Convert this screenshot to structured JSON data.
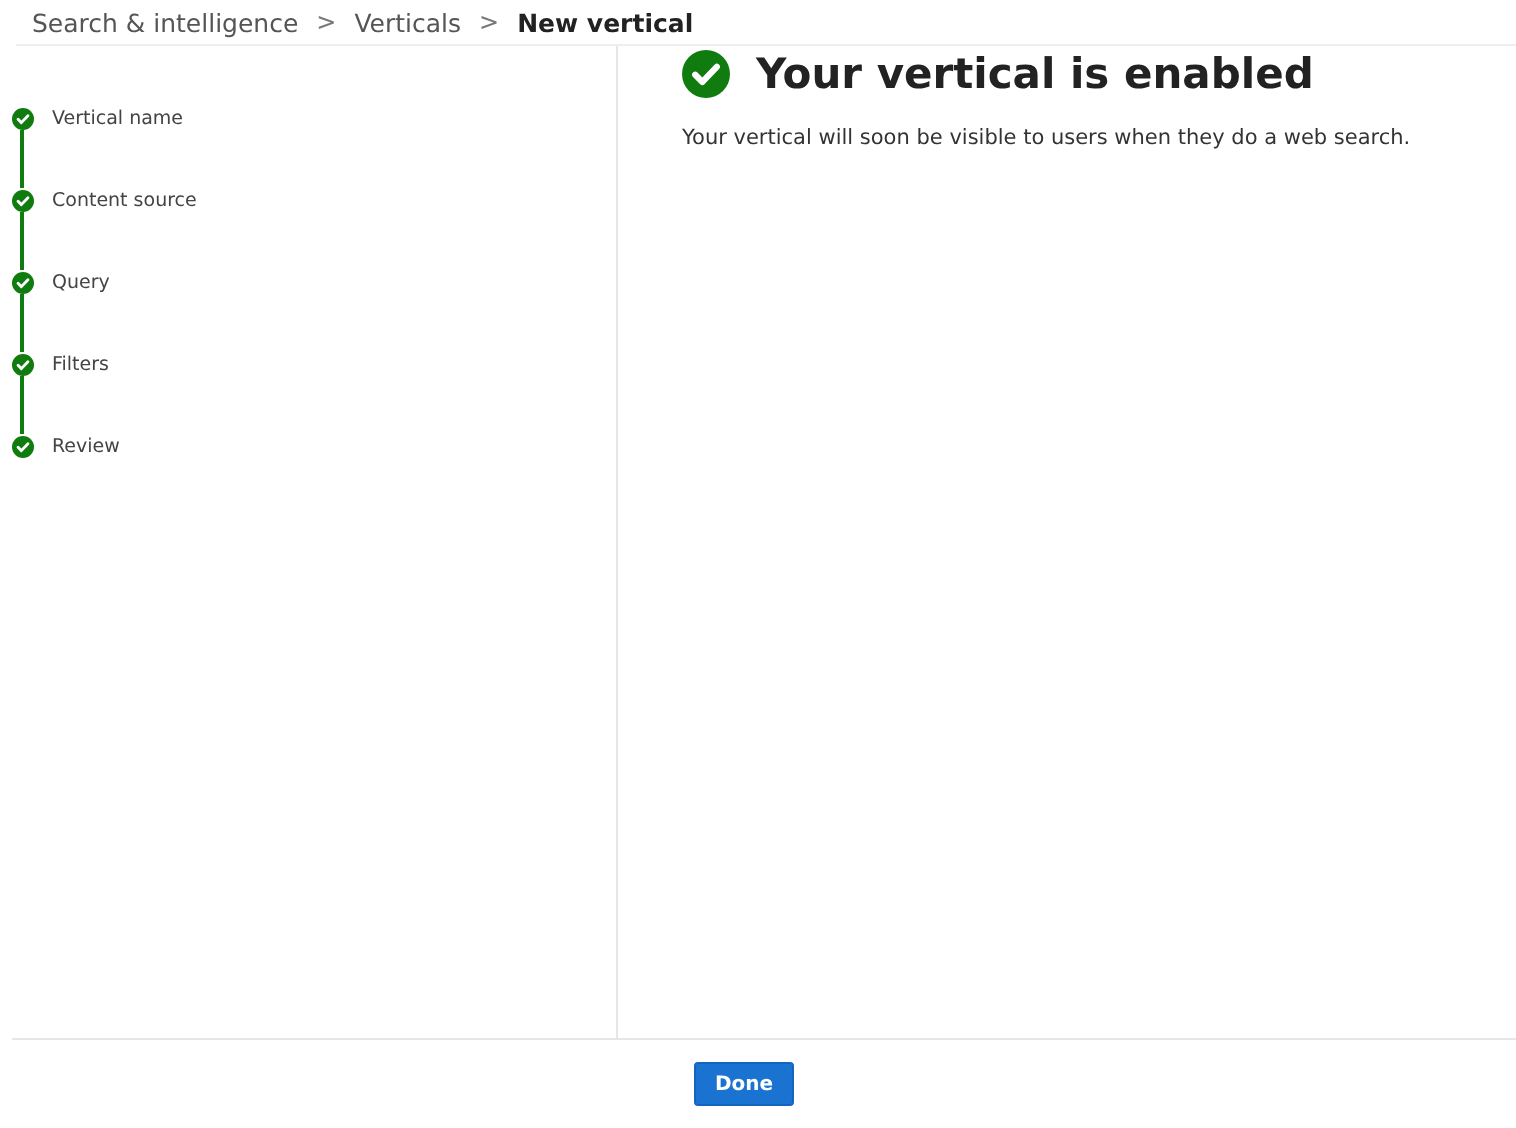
{
  "breadcrumb": [
    {
      "label": "Search & intelligence",
      "current": false
    },
    {
      "label": "Verticals",
      "current": false
    },
    {
      "label": "New vertical",
      "current": true
    }
  ],
  "breadcrumb_separator": ">",
  "steps": [
    {
      "label": "Vertical name",
      "completed": true
    },
    {
      "label": "Content source",
      "completed": true
    },
    {
      "label": "Query",
      "completed": true
    },
    {
      "label": "Filters",
      "completed": true
    },
    {
      "label": "Review",
      "completed": true
    }
  ],
  "result": {
    "title": "Your vertical is enabled",
    "message": "Your vertical will soon be visible to users when they do a web search."
  },
  "buttons": [
    "Done"
  ]
}
